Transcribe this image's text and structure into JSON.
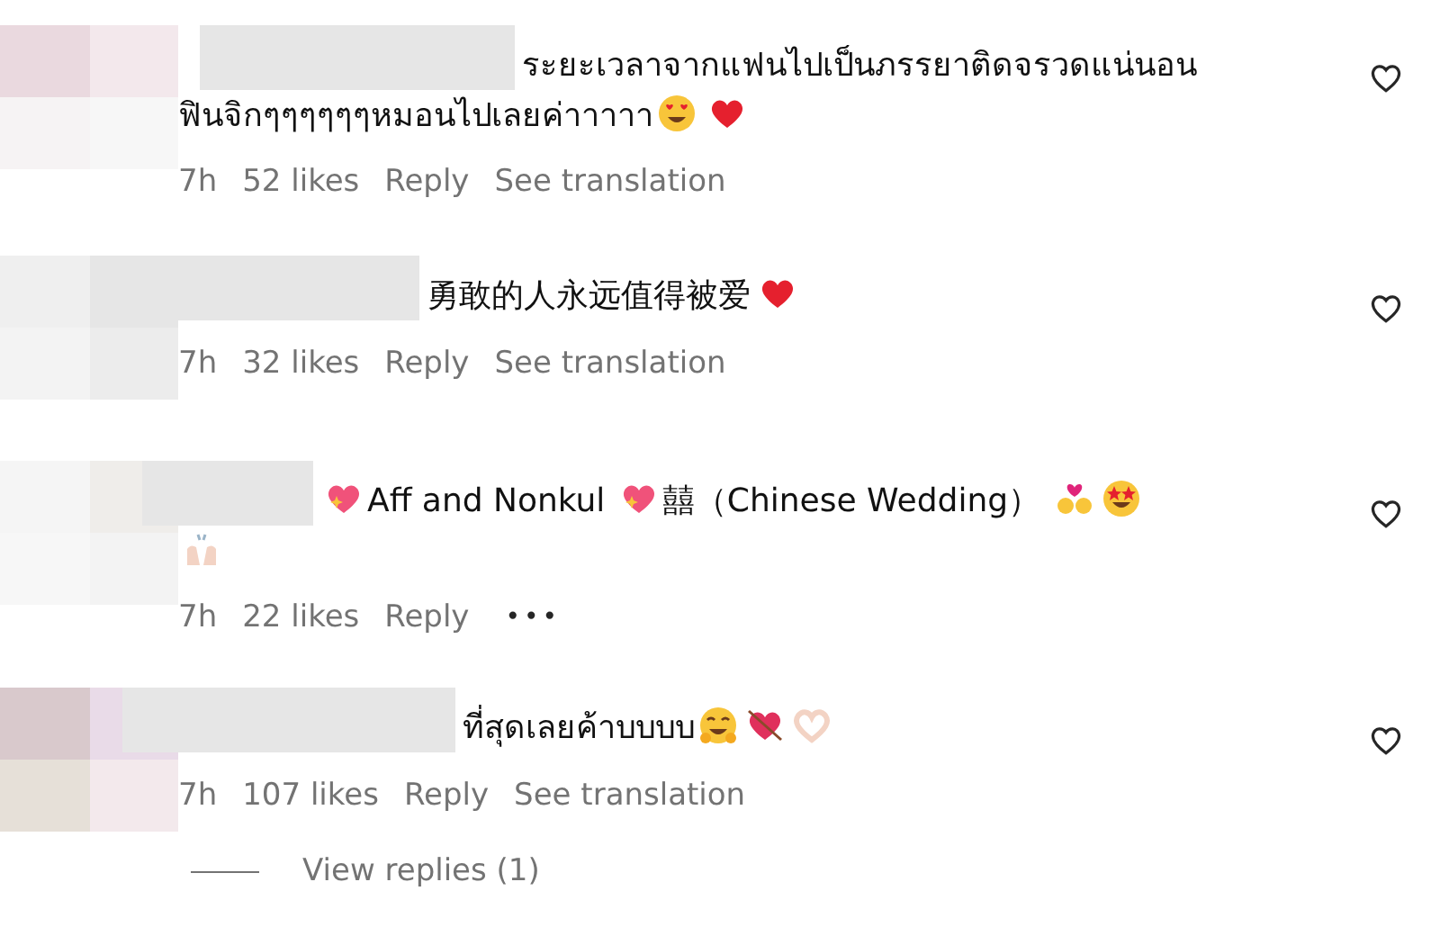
{
  "comments": [
    {
      "parts": [
        {
          "kind": "text",
          "text": "ระยะเวลาจากแฟนไปเป็นภรรยาติดจรวดแน่นอน"
        },
        {
          "kind": "break"
        },
        {
          "kind": "text",
          "text": "ฟินจิกๆๆๆๆๆๆหมอนไปเลยค่าาาาา"
        },
        {
          "kind": "heart-eyes"
        },
        {
          "kind": "heart"
        }
      ],
      "time": "7h",
      "likes": "52 likes",
      "reply": "Reply",
      "translate": "See translation",
      "liked": false
    },
    {
      "parts": [
        {
          "kind": "text",
          "text": "勇敢的人永远值得被爱"
        },
        {
          "kind": "heart"
        }
      ],
      "time": "7h",
      "likes": "32 likes",
      "reply": "Reply",
      "translate": "See translation",
      "liked": false
    },
    {
      "parts": [
        {
          "kind": "sparkle-heart"
        },
        {
          "kind": "text",
          "text": "Aff and Nonkul "
        },
        {
          "kind": "sparkle-heart"
        },
        {
          "kind": "text",
          "text": "囍（Chinese Wedding） "
        },
        {
          "kind": "couple"
        },
        {
          "kind": "star-eyes"
        },
        {
          "kind": "break"
        },
        {
          "kind": "raised-hands"
        }
      ],
      "time": "7h",
      "likes": "22 likes",
      "reply": "Reply",
      "more": "•••",
      "liked": false
    },
    {
      "parts": [
        {
          "kind": "text",
          "text": "ที่สุดเลยค้าบบบบ"
        },
        {
          "kind": "hug"
        },
        {
          "kind": "arrow-heart"
        },
        {
          "kind": "heart-hands"
        }
      ],
      "time": "7h",
      "likes": "107 likes",
      "reply": "Reply",
      "translate": "See translation",
      "liked": false
    }
  ],
  "view_replies": "View replies (1)"
}
